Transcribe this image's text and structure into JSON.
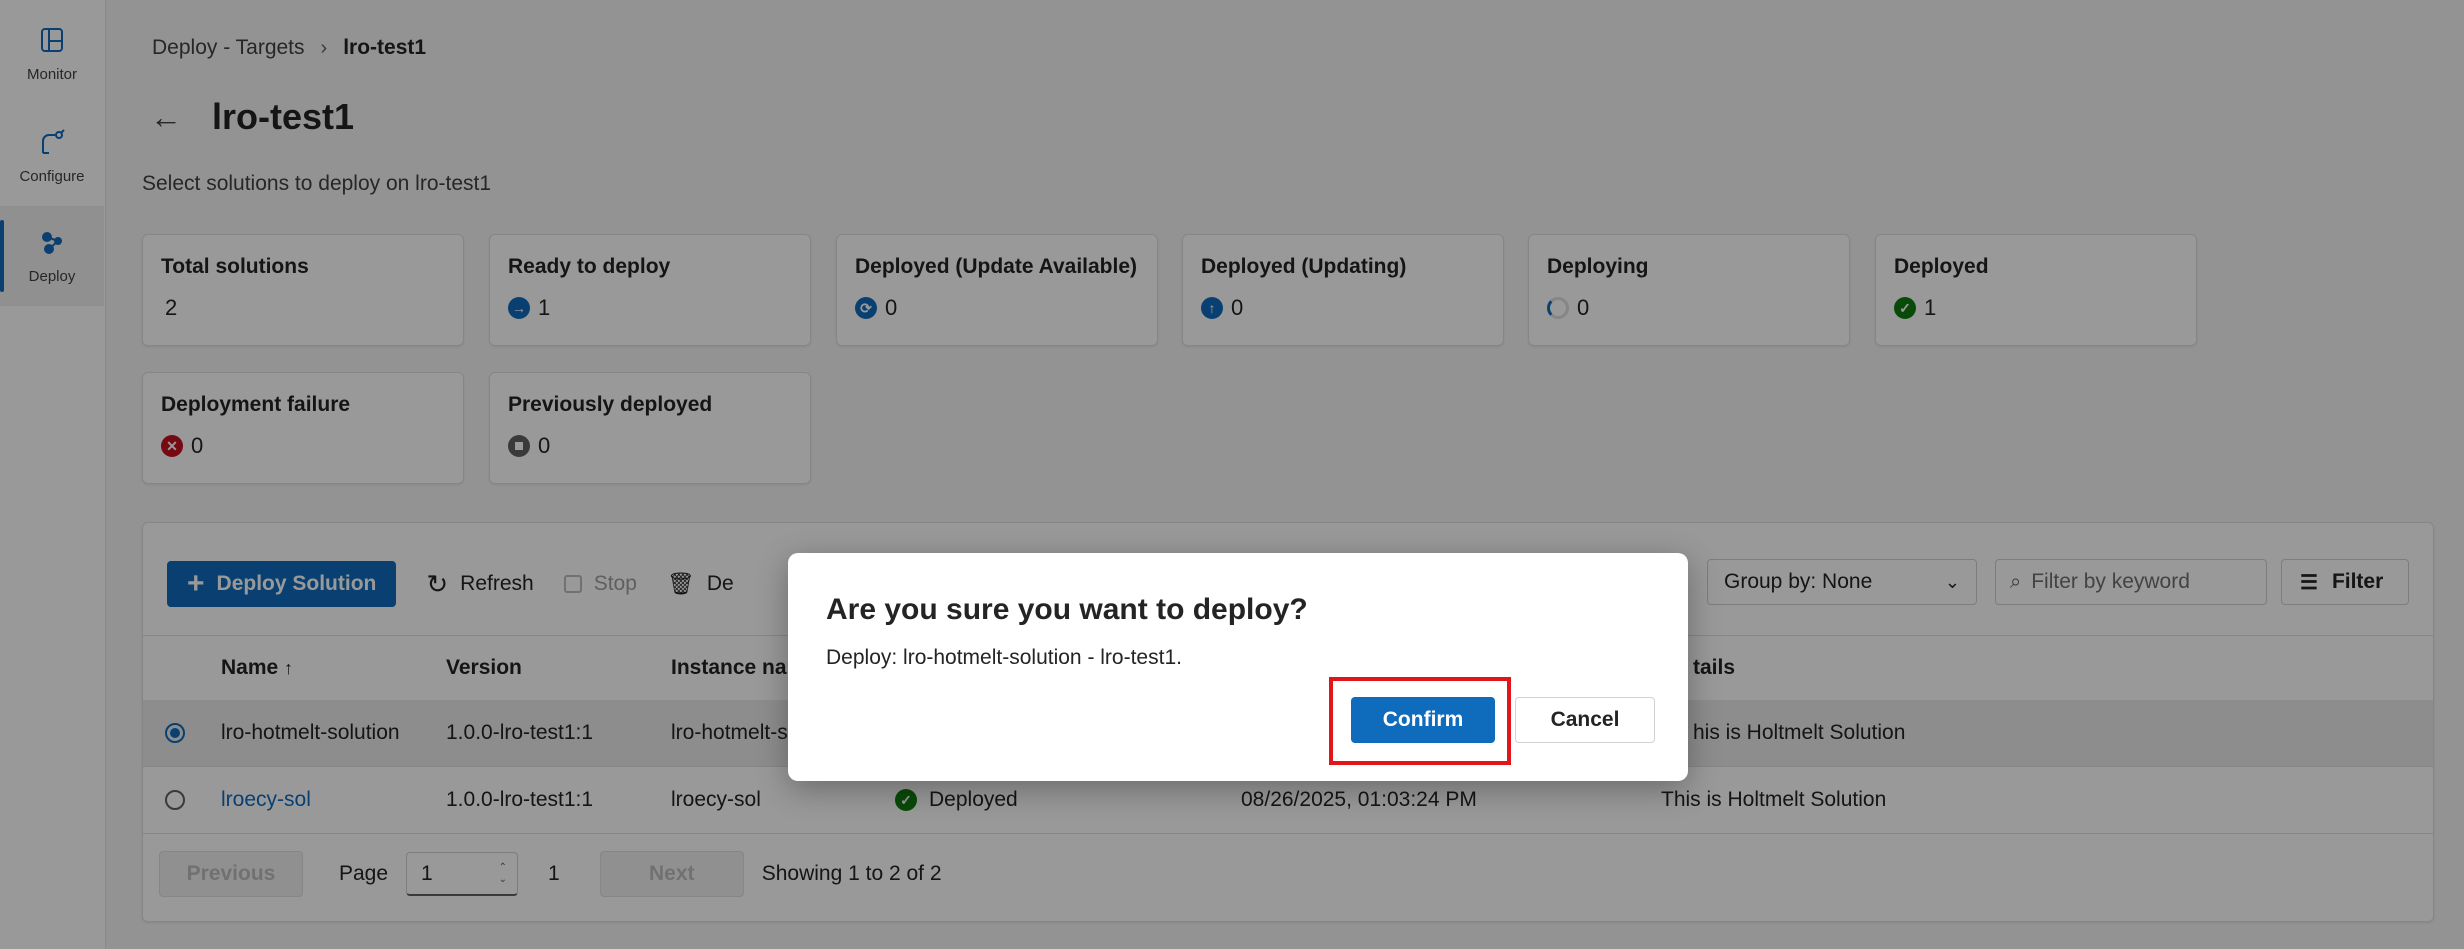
{
  "rail": {
    "items": [
      {
        "label": "Monitor",
        "icon": "monitor-icon"
      },
      {
        "label": "Configure",
        "icon": "configure-icon"
      },
      {
        "label": "Deploy",
        "icon": "deploy-icon",
        "active": true
      }
    ]
  },
  "breadcrumb": {
    "parent": "Deploy - Targets",
    "current": "lro-test1"
  },
  "page": {
    "title": "lro-test1",
    "subtitle": "Select solutions to deploy on lro-test1"
  },
  "cards": [
    {
      "title": "Total solutions",
      "value": "2"
    },
    {
      "title": "Ready to deploy",
      "value": "1",
      "color": "#0f6cbd"
    },
    {
      "title": "Deployed (Update Available)",
      "value": "0",
      "color": "#0f6cbd"
    },
    {
      "title": "Deployed (Updating)",
      "value": "0",
      "color": "#0f6cbd"
    },
    {
      "title": "Deploying",
      "value": "0",
      "color": "#0f6cbd"
    },
    {
      "title": "Deployed",
      "value": "1",
      "color": "#107c10"
    },
    {
      "title": "Deployment failure",
      "value": "0",
      "color": "#c50f1f"
    },
    {
      "title": "Previously deployed",
      "value": "0",
      "color": "#616161"
    }
  ],
  "toolbar": {
    "deploy": "Deploy Solution",
    "refresh": "Refresh",
    "stop": "Stop",
    "delete": "De",
    "group_by": "Group by: None",
    "filter_placeholder": "Filter by keyword",
    "filter": "Filter"
  },
  "table": {
    "columns": {
      "name": "Name",
      "version": "Version",
      "instance": "Instance nan",
      "details": "tails"
    },
    "rows": [
      {
        "name": "lro-hotmelt-solution",
        "version": "1.0.0-lro-test1:1",
        "instance": "lro-hotmelt-s",
        "status": "",
        "date": "",
        "details": "his is Holtmelt Solution"
      },
      {
        "name": "lroecy-sol",
        "version": "1.0.0-lro-test1:1",
        "instance": "lroecy-sol",
        "status": "Deployed",
        "date": "08/26/2025, 01:03:24 PM",
        "details": "This is Holtmelt Solution"
      }
    ]
  },
  "pager": {
    "previous": "Previous",
    "page_label": "Page",
    "page_value": "1",
    "total_pages": "1",
    "next": "Next",
    "showing": "Showing 1 to 2 of 2"
  },
  "dialog": {
    "title": "Are you sure you want to deploy?",
    "message": "Deploy: lro-hotmelt-solution - lro-test1.",
    "confirm": "Confirm",
    "cancel": "Cancel",
    "highlight_color": "#e0161b"
  }
}
